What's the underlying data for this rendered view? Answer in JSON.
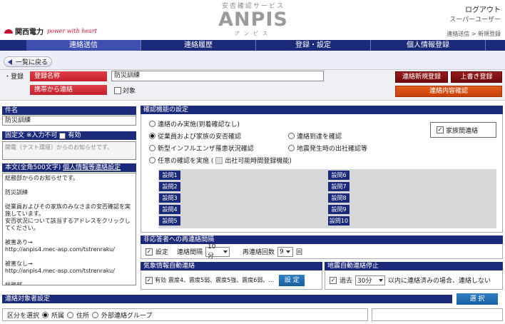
{
  "header": {
    "brand_name": "関西電力",
    "brand_tagline": "power with heart",
    "logo_subtitle": "安否確認サービス",
    "logo_main": "ANPIS",
    "logo_kana": "アンピス",
    "logout": "ログアウト",
    "username": "スーパーユーザー",
    "breadcrumb": "連絡送信 > 新規登録"
  },
  "nav": {
    "tabs": [
      {
        "label": "連絡送信"
      },
      {
        "label": "連絡履歴"
      },
      {
        "label": "登録・設定"
      },
      {
        "label": "個人情報登録"
      }
    ]
  },
  "back_button": "一覧に戻る",
  "registration": {
    "section_label": "・登録",
    "name_label": "登録名称",
    "name_value": "防災訓練",
    "mobile_label": "携帯から連絡",
    "mobile_checkbox_label": "対象",
    "btn_new": "連絡新規登録",
    "btn_overwrite": "上書き登録",
    "btn_confirm": "連絡内容確認"
  },
  "subject": {
    "head": "件名",
    "value": "防災訓練"
  },
  "fixed_text": {
    "head": "固定文 ※入力不可",
    "checkbox_label": "有効",
    "value": "関電（テスト環境）からのお知らせです。"
  },
  "body": {
    "head_prefix": "本文(全角500文字)",
    "head_link": "個人情報等連絡設定",
    "text": "総務部からのお知らせです。\n\n防災訓練\n\n従業員およびその家族のみなさまの安否確認を実施しています。\n安否状況について該当するアドレスをクリックしてください。\n\n被害あり→\nhttp://anpis4.mec-asp.com/tstrenraku/\n\n被害なし→\nhttp://anpis4.mec-asp.com/tstrenraku/\n\n総務部"
  },
  "confirm": {
    "head": "確認機能の設定",
    "opt_contact_only": "連絡のみ実施(到着確認なし)",
    "opt_employee_family": "従業員および家族の安否確認",
    "opt_influenza": "新型インフルエンザ罹患状況確認",
    "opt_custom": "任意の確認を実施 (",
    "opt_custom_sub": "出社可能時間登録機能)",
    "opt_arrival": "連絡到達を確認",
    "opt_earthquake": "地震発生時の出社確認等",
    "family_contact": "家族間連絡",
    "questions": [
      "設問1",
      "設問2",
      "設問3",
      "設問4",
      "設問5",
      "設問6",
      "設問7",
      "設問8",
      "設問9",
      "設問10"
    ]
  },
  "resend": {
    "head": "非応答者への再連絡間隔",
    "enable_label": "設定",
    "interval_label": "連絡間隔",
    "interval_value": "10分",
    "count_label": "再連絡回数",
    "count_value": "9",
    "count_unit": "回"
  },
  "weather": {
    "head": "気象情報自動連絡",
    "enable_label": "有効",
    "summary": "震度4、震度5弱、震度5強、震度6弱、…",
    "btn": "設 定"
  },
  "quake": {
    "head": "地震自動連絡停止",
    "enable_label": "過去",
    "minutes_value": "30分",
    "suffix": "以内に連絡済みの場合、連絡しない"
  },
  "target": {
    "head": "連絡対象者設定",
    "select_btn": "選 択",
    "section_label": "区分を選択",
    "opt_dept": "所属",
    "opt_address": "住所",
    "opt_external": "外部連絡グループ"
  }
}
